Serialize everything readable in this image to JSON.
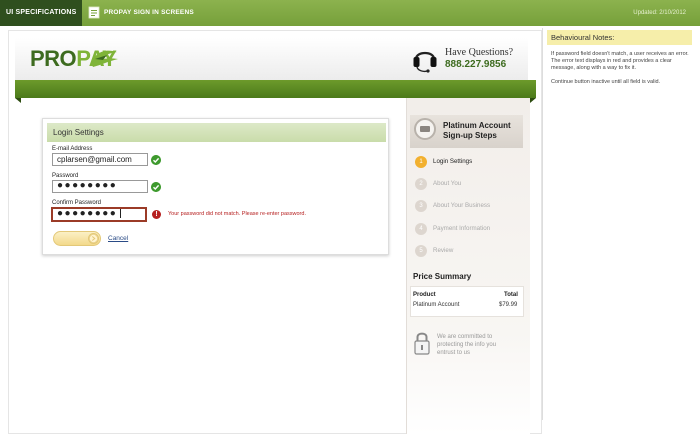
{
  "topbar": {
    "spec_tab": "UI SPECIFICATIONS",
    "doc_title": "PROPAY SIGN IN SCREENS",
    "updated": "Updated: 2/10/2012"
  },
  "header": {
    "logo_pro": "PRO",
    "logo_pay": "PAY",
    "help_label": "Have Questions?",
    "help_phone": "888.227.9856"
  },
  "login": {
    "title": "Login Settings",
    "email_label": "E-mail Address",
    "email_value": "cplarsen@gmail.com",
    "password_label": "Password",
    "password_value": "●●●●●●●●",
    "confirm_label": "Confirm Password",
    "confirm_value": "●●●●●●●●",
    "error_message": "Your password did not match. Please re-enter password.",
    "error_icon": "!",
    "cancel_label": "Cancel"
  },
  "steps": {
    "title": "Platinum Account Sign-up Steps",
    "items": [
      {
        "num": "1",
        "label": "Login Settings",
        "active": true
      },
      {
        "num": "2",
        "label": "About You",
        "active": false
      },
      {
        "num": "3",
        "label": "About Your Business",
        "active": false
      },
      {
        "num": "4",
        "label": "Payment Information",
        "active": false
      },
      {
        "num": "5",
        "label": "Review",
        "active": false
      }
    ]
  },
  "price": {
    "title": "Price Summary",
    "col_product": "Product",
    "col_total": "Total",
    "product": "Platinum Account",
    "total": "$79.99"
  },
  "security": {
    "text": "We are committed to protecting the info you entrust to us"
  },
  "notes": {
    "title": "Behavioural Notes:",
    "paragraphs": [
      "If password field doesn't match, a user receives an error.  The error text displays in red and provides a clear message, along with a way to fix it.",
      "Continue button inactive until all field is valid."
    ]
  },
  "colors": {
    "brand_green": "#76a03a",
    "dark_green": "#2f4f1e",
    "error_red": "#b62020",
    "step_active": "#f2b02f"
  }
}
